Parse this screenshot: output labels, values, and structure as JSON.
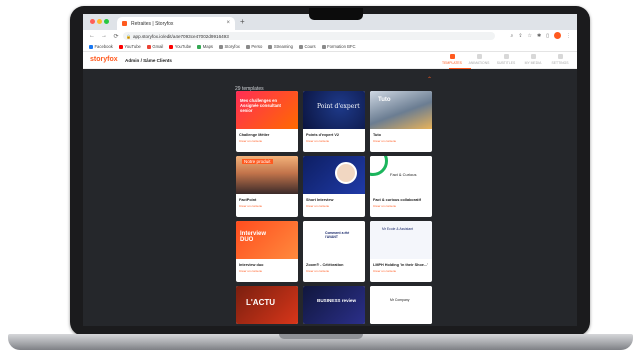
{
  "browser": {
    "tab_title": "Retraites | Storyfox",
    "close_glyph": "×",
    "new_tab_glyph": "+",
    "url": "app.storyfox.io/edit/a4e7093ce47002d9916493",
    "nav": {
      "back": "←",
      "forward": "→",
      "reload": "⟳"
    },
    "bookmarks": [
      {
        "label": "Facebook",
        "color": "#1877f2"
      },
      {
        "label": "YouTube",
        "color": "#ff0000"
      },
      {
        "label": "Gmail",
        "color": "#ea4335"
      },
      {
        "label": "YouTube",
        "color": "#ff0000"
      },
      {
        "label": "Maps",
        "color": "#34a853"
      },
      {
        "label": "Storyfox",
        "color": "#8a8a8a"
      },
      {
        "label": "Perso",
        "color": "#8a8a8a"
      },
      {
        "label": "Streaming",
        "color": "#8a8a8a"
      },
      {
        "label": "Cours",
        "color": "#8a8a8a"
      },
      {
        "label": "Formation BFC",
        "color": "#8a8a8a"
      }
    ]
  },
  "app": {
    "logo": "storyfox",
    "breadcrumb": "Admin / Sâme Clients",
    "accent": "#ff5a1f",
    "nav_items": [
      {
        "label": "TEMPLATES",
        "active": true
      },
      {
        "label": "ANIMATIONS",
        "active": false
      },
      {
        "label": "SUBTITLES",
        "active": false
      },
      {
        "label": "MY MEDIA",
        "active": false
      },
      {
        "label": "SETTINGS",
        "active": false
      }
    ]
  },
  "templates": {
    "count_label": "29 templates",
    "collapse_glyph": "⌃",
    "cards": [
      {
        "title": "Challenge Métier",
        "subtitle": "Créer un contenu",
        "thumb_style": "gradient-red",
        "thumb_text": "Mes challenges en Assignée consultant senior"
      },
      {
        "title": "Points d'expert V2",
        "subtitle": "Créer un contenu",
        "thumb_style": "navy",
        "thumb_text": "Point d'expert"
      },
      {
        "title": "Tuto",
        "subtitle": "Créer un contenu",
        "thumb_style": "photo-blue",
        "thumb_text": "Tuto"
      },
      {
        "title": "FactPoint",
        "subtitle": "Créer un contenu",
        "thumb_style": "photo-sunset",
        "thumb_text": "Notre produit"
      },
      {
        "title": "Short Interview",
        "subtitle": "Créer un contenu",
        "thumb_style": "navy-portrait",
        "thumb_text": ""
      },
      {
        "title": "Fact & curious collaboratif",
        "subtitle": "Créer un contenu",
        "thumb_style": "white-green",
        "thumb_text": "Fact & Curious"
      },
      {
        "title": "Interview duo",
        "subtitle": "Créer un contenu",
        "thumb_style": "orange",
        "thumb_text": "Interview DUO"
      },
      {
        "title": "Zoom® - Célébration",
        "subtitle": "Créer un contenu",
        "thumb_style": "white-illustration",
        "thumb_text": "Comment a été l'AVANT"
      },
      {
        "title": "LMPH Holding 'in their Shoe...'",
        "subtitle": "Créer un contenu",
        "thumb_style": "white-pattern",
        "thumb_text": "Mr Ecole & Assistant"
      },
      {
        "title": "",
        "subtitle": "",
        "thumb_style": "actu",
        "thumb_text": "L'ACTU"
      },
      {
        "title": "",
        "subtitle": "",
        "thumb_style": "navy-business",
        "thumb_text": "BUSINESS review"
      },
      {
        "title": "",
        "subtitle": "",
        "thumb_style": "white-company",
        "thumb_text": "Mr Company"
      }
    ]
  }
}
